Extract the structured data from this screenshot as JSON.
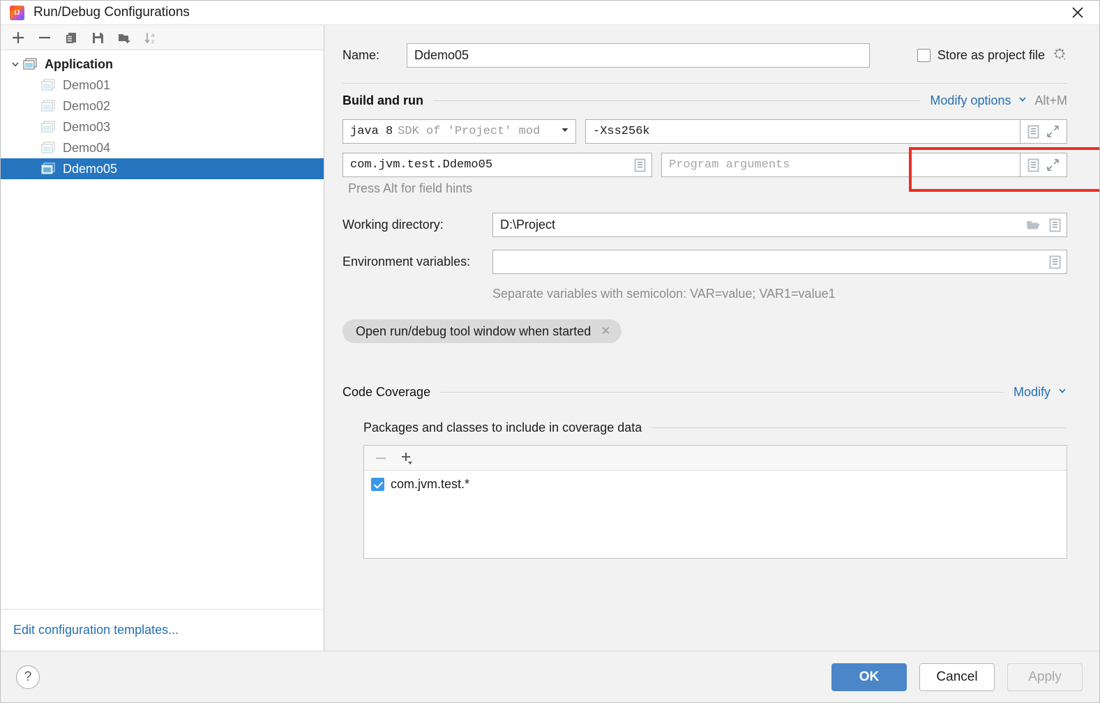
{
  "window": {
    "title": "Run/Debug Configurations",
    "logo_icon": "intellij-idea-logo",
    "close_icon": "close-icon"
  },
  "sidebar": {
    "toolbar": [
      {
        "name": "add",
        "icon": "plus-icon",
        "enabled": true
      },
      {
        "name": "remove",
        "icon": "minus-icon",
        "enabled": true
      },
      {
        "name": "copy",
        "icon": "copy-icon",
        "enabled": true
      },
      {
        "name": "save",
        "icon": "save-icon",
        "enabled": true
      },
      {
        "name": "new-folder",
        "icon": "folder-add-icon",
        "enabled": true
      },
      {
        "name": "sort-alphabetically",
        "icon": "sort-az-icon",
        "enabled": false
      }
    ],
    "tree": {
      "group_label": "Application",
      "group_icon": "application-icon",
      "expand_icon": "chevron-down-icon",
      "items": [
        {
          "label": "Demo01",
          "selected": false
        },
        {
          "label": "Demo02",
          "selected": false
        },
        {
          "label": "Demo03",
          "selected": false
        },
        {
          "label": "Demo04",
          "selected": false
        },
        {
          "label": "Ddemo05",
          "selected": true
        }
      ]
    },
    "footer_link": "Edit configuration templates..."
  },
  "main": {
    "name_label": "Name:",
    "name_value": "Ddemo05",
    "store_as_project_file_label": "Store as project file",
    "store_as_project_file_checked": false,
    "store_gear_icon": "gear-icon",
    "build_and_run": {
      "section_title": "Build and run",
      "modify_options_label": "Modify options",
      "modify_options_shortcut": "Alt+M",
      "jdk_main": "java 8",
      "jdk_sub": "SDK of 'Project' mod",
      "jdk_caret_icon": "chevron-down-icon",
      "vm_options_value": "-Xss256k",
      "vm_options_highlighted": true,
      "main_class_value": "com.jvm.test.Ddemo05",
      "program_arguments_placeholder": "Program arguments",
      "macro_icon": "macro-document-icon",
      "expand_icon": "expand-diagonal-icon",
      "field_hint": "Press Alt for field hints"
    },
    "working_directory_label": "Working directory:",
    "working_directory_value": "D:\\Project",
    "browse_icon": "folder-open-icon",
    "environment_variables_label": "Environment variables:",
    "environment_variables_value": "",
    "environment_hint": "Separate variables with semicolon: VAR=value; VAR1=value1",
    "chip_label": "Open run/debug tool window when started",
    "chip_close_icon": "close-small-icon",
    "code_coverage": {
      "section_title": "Code Coverage",
      "modify_label": "Modify",
      "modify_caret_icon": "chevron-down-icon",
      "subsection_title": "Packages and classes to include in coverage data",
      "toolbar": [
        {
          "name": "remove-package",
          "icon": "minus-icon",
          "enabled": false
        },
        {
          "name": "add-package",
          "icon": "plus-dropdown-icon",
          "enabled": true
        }
      ],
      "items": [
        {
          "label": "com.jvm.test.*",
          "checked": true
        }
      ]
    }
  },
  "footer": {
    "help_icon": "question-mark-icon",
    "ok_label": "OK",
    "cancel_label": "Cancel",
    "apply_label": "Apply",
    "apply_enabled": false
  },
  "colors": {
    "accent_blue": "#2470b3",
    "selection_blue": "#2675bf",
    "primary_button": "#4a86c8",
    "annotation_red": "#ee2d24",
    "checkbox_blue": "#3b97e8"
  }
}
